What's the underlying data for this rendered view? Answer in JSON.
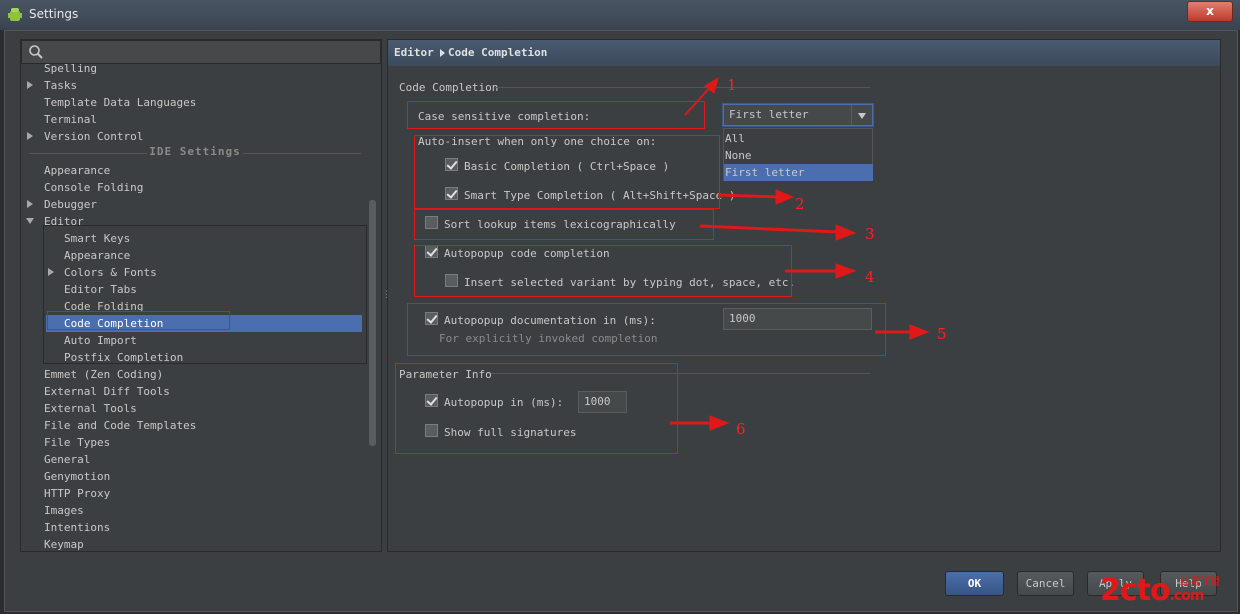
{
  "window": {
    "title": "Settings",
    "close_label": "x"
  },
  "tree": {
    "items_top": [
      {
        "label": "Spelling",
        "expandable": false
      },
      {
        "label": "Tasks",
        "expandable": true
      },
      {
        "label": "Template Data Languages",
        "expandable": false
      },
      {
        "label": "Terminal",
        "expandable": false
      },
      {
        "label": "Version Control",
        "expandable": true
      }
    ],
    "section_title": "IDE Settings",
    "items_ide": [
      {
        "label": "Appearance"
      },
      {
        "label": "Console Folding"
      },
      {
        "label": "Debugger"
      },
      {
        "label": "Editor"
      }
    ],
    "editor_children": [
      "Smart Keys",
      "Appearance",
      "Colors & Fonts",
      "Editor Tabs",
      "Code Folding",
      "Code Completion",
      "Auto Import",
      "Postfix Completion"
    ],
    "items_after": [
      "Emmet (Zen Coding)",
      "External Diff Tools",
      "External Tools",
      "File and Code Templates",
      "File Types",
      "General",
      "Genymotion",
      "HTTP Proxy",
      "Images",
      "Intentions",
      "Keymap"
    ]
  },
  "breadcrumb": {
    "parent": "Editor",
    "current": "Code Completion"
  },
  "code_completion": {
    "group_title": "Code Completion",
    "case_sensitive_label": "Case sensitive completion:",
    "case_sensitive_value": "First letter",
    "case_sensitive_options": [
      "All",
      "None",
      "First letter"
    ],
    "auto_insert_label": "Auto-insert when only one choice on:",
    "basic_completion_label": "Basic Completion ( Ctrl+Space )",
    "basic_completion_checked": true,
    "smart_type_label": "Smart Type Completion ( Alt+Shift+Space )",
    "smart_type_checked": true,
    "sort_lookup_label": "Sort lookup items lexicographically",
    "sort_lookup_checked": false,
    "autopopup_label": "Autopopup code completion",
    "autopopup_checked": true,
    "insert_variant_label": "Insert selected variant by typing dot, space, etc.",
    "insert_variant_checked": false,
    "autopopup_doc_label": "Autopopup documentation in (ms):",
    "autopopup_doc_checked": true,
    "autopopup_doc_value": "1000",
    "autopopup_doc_hint": "For explicitly invoked completion"
  },
  "parameter_info": {
    "group_title": "Parameter Info",
    "autopopup_label": "Autopopup in (ms):",
    "autopopup_checked": true,
    "autopopup_value": "1000",
    "show_full_label": "Show full signatures",
    "show_full_checked": false
  },
  "annotations": [
    "1",
    "2",
    "3",
    "4",
    "5",
    "6"
  ],
  "buttons": {
    "ok": "OK",
    "cancel": "Cancel",
    "apply": "Apply",
    "help": "Help"
  },
  "watermark": {
    "brand": "2cto",
    "suffix": ".com",
    "sub": "红黑联盟"
  },
  "colors": {
    "selection": "#4b6eaf",
    "annotation": "#e01818",
    "background": "#3c3f41"
  }
}
